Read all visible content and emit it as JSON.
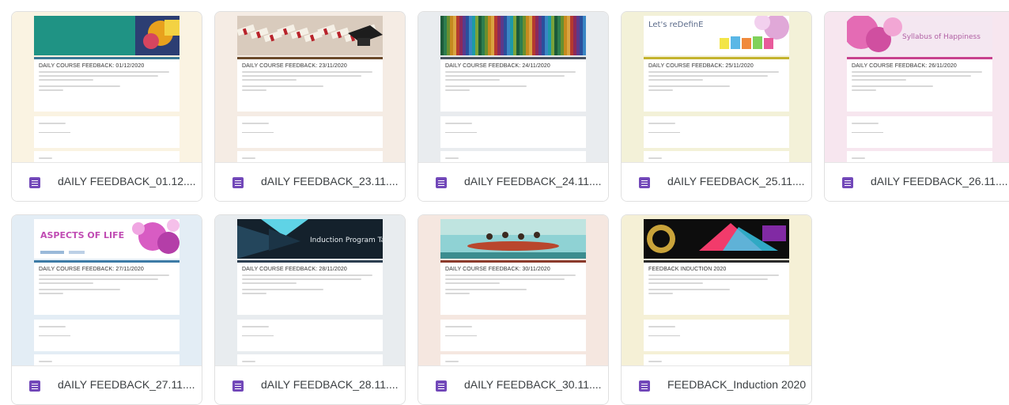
{
  "files": [
    {
      "name": "dAILY FEEDBACK_01.12....",
      "form_title": "DAILY COURSE FEEDBACK: 01/12/2020",
      "bg": "#faf3e2",
      "accent": "#3c7a96",
      "banner": "teal",
      "banner_text": ""
    },
    {
      "name": "dAILY FEEDBACK_23.11....",
      "form_title": "DAILY COURSE FEEDBACK: 23/11/2020",
      "bg": "#f5ece4",
      "accent": "#6b4a2b",
      "banner": "graduation",
      "banner_text": ""
    },
    {
      "name": "dAILY FEEDBACK_24.11....",
      "form_title": "DAILY COURSE FEEDBACK: 24/11/2020",
      "bg": "#e9ecef",
      "accent": "#4b5563",
      "banner": "stripes",
      "banner_text": ""
    },
    {
      "name": "dAILY FEEDBACK_25.11....",
      "form_title": "DAILY COURSE FEEDBACK: 25/11/2020",
      "bg": "#f3f1d8",
      "accent": "#c4b32d",
      "banner": "life",
      "banner_text": "Let's reDefinE"
    },
    {
      "name": "dAILY FEEDBACK_26.11....",
      "form_title": "DAILY COURSE FEEDBACK: 26/11/2020",
      "bg": "#f7e6ef",
      "accent": "#c7418e",
      "banner": "happiness",
      "banner_text": "Syllabus of Happiness"
    },
    {
      "name": "dAILY FEEDBACK_27.11....",
      "form_title": "DAILY COURSE FEEDBACK: 27/11/2020",
      "bg": "#e3edf5",
      "accent": "#3d7ba6",
      "banner": "aspects",
      "banner_text": "ASPECTS OF LIFE"
    },
    {
      "name": "dAILY FEEDBACK_28.11....",
      "form_title": "DAILY COURSE FEEDBACK: 28/11/2020",
      "bg": "#e8ecef",
      "accent": "#2c3e50",
      "banner": "induction",
      "banner_text": "Induction Program Talk"
    },
    {
      "name": "dAILY FEEDBACK_30.11....",
      "form_title": "DAILY COURSE FEEDBACK: 30/11/2020",
      "bg": "#f5e7e0",
      "accent": "#8b3a2b",
      "banner": "boat",
      "banner_text": ""
    },
    {
      "name": "FEEDBACK_Induction 2020",
      "form_title": "FEEDBACK INDUCTION 2020",
      "bg": "#f5f0d6",
      "accent": "#2a2a2a",
      "banner": "dark",
      "banner_text": ""
    }
  ]
}
